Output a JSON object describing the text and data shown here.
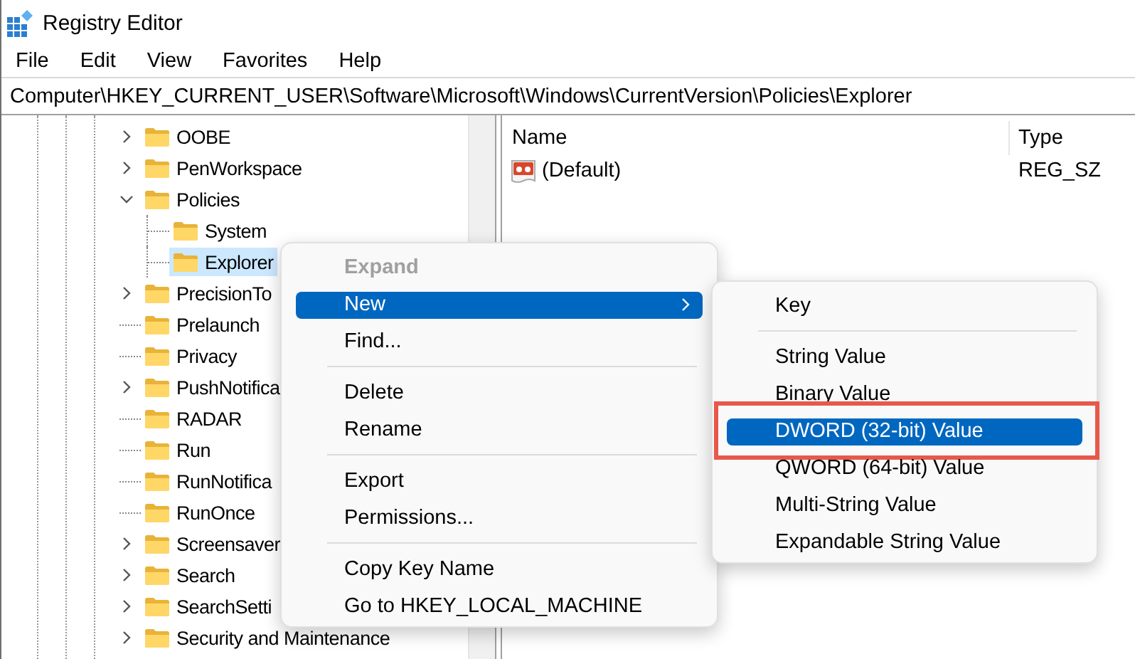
{
  "window": {
    "title": "Registry Editor"
  },
  "menu_bar": [
    "File",
    "Edit",
    "View",
    "Favorites",
    "Help"
  ],
  "address_bar": {
    "value": "Computer\\HKEY_CURRENT_USER\\Software\\Microsoft\\Windows\\CurrentVersion\\Policies\\Explorer"
  },
  "tree": {
    "items": [
      {
        "label": "OOBE",
        "expandable": true,
        "expanded": false,
        "selected": false
      },
      {
        "label": "PenWorkspace",
        "expandable": true,
        "expanded": false,
        "selected": false
      },
      {
        "label": "Policies",
        "expandable": true,
        "expanded": true,
        "selected": false,
        "children": [
          {
            "label": "System",
            "expandable": false,
            "selected": false
          },
          {
            "label": "Explorer",
            "expandable": false,
            "selected": true
          }
        ]
      },
      {
        "label": "PrecisionTo",
        "expandable": true,
        "expanded": false,
        "selected": false
      },
      {
        "label": "Prelaunch",
        "expandable": false,
        "selected": false
      },
      {
        "label": "Privacy",
        "expandable": false,
        "selected": false
      },
      {
        "label": "PushNotifica",
        "expandable": true,
        "expanded": false,
        "selected": false
      },
      {
        "label": "RADAR",
        "expandable": false,
        "selected": false
      },
      {
        "label": "Run",
        "expandable": false,
        "selected": false
      },
      {
        "label": "RunNotifica",
        "expandable": false,
        "selected": false
      },
      {
        "label": "RunOnce",
        "expandable": false,
        "selected": false
      },
      {
        "label": "Screensaver",
        "expandable": true,
        "expanded": false,
        "selected": false
      },
      {
        "label": "Search",
        "expandable": true,
        "expanded": false,
        "selected": false
      },
      {
        "label": "SearchSetti",
        "expandable": true,
        "expanded": false,
        "selected": false
      },
      {
        "label": "Security and Maintenance",
        "expandable": true,
        "expanded": false,
        "selected": false
      }
    ]
  },
  "values": {
    "columns": [
      "Name",
      "Type"
    ],
    "rows": [
      {
        "name": "(Default)",
        "type": "REG_SZ"
      }
    ]
  },
  "context_menu": {
    "items": [
      {
        "kind": "item",
        "label": "Expand",
        "default": true,
        "disabled": true,
        "selected": false
      },
      {
        "kind": "submenu",
        "label": "New",
        "default": false,
        "disabled": false,
        "selected": true,
        "submenu": {
          "items": [
            {
              "kind": "item",
              "label": "Key",
              "selected": false,
              "annotated": false
            },
            {
              "kind": "separator"
            },
            {
              "kind": "item",
              "label": "String Value",
              "selected": false,
              "annotated": false
            },
            {
              "kind": "item",
              "label": "Binary Value",
              "selected": false,
              "annotated": false
            },
            {
              "kind": "item",
              "label": "DWORD (32-bit) Value",
              "selected": true,
              "annotated": true
            },
            {
              "kind": "item",
              "label": "QWORD (64-bit) Value",
              "selected": false,
              "annotated": false
            },
            {
              "kind": "item",
              "label": "Multi-String Value",
              "selected": false,
              "annotated": false
            },
            {
              "kind": "item",
              "label": "Expandable String Value",
              "selected": false,
              "annotated": false
            }
          ]
        }
      },
      {
        "kind": "item",
        "label": "Find...",
        "default": false,
        "disabled": false,
        "selected": false
      },
      {
        "kind": "separator"
      },
      {
        "kind": "item",
        "label": "Delete",
        "default": false,
        "disabled": false,
        "selected": false
      },
      {
        "kind": "item",
        "label": "Rename",
        "default": false,
        "disabled": false,
        "selected": false
      },
      {
        "kind": "separator"
      },
      {
        "kind": "item",
        "label": "Export",
        "default": false,
        "disabled": false,
        "selected": false
      },
      {
        "kind": "item",
        "label": "Permissions...",
        "default": false,
        "disabled": false,
        "selected": false
      },
      {
        "kind": "separator"
      },
      {
        "kind": "item",
        "label": "Copy Key Name",
        "default": false,
        "disabled": false,
        "selected": false
      },
      {
        "kind": "item",
        "label": "Go to HKEY_LOCAL_MACHINE",
        "default": false,
        "disabled": false,
        "selected": false
      }
    ]
  }
}
